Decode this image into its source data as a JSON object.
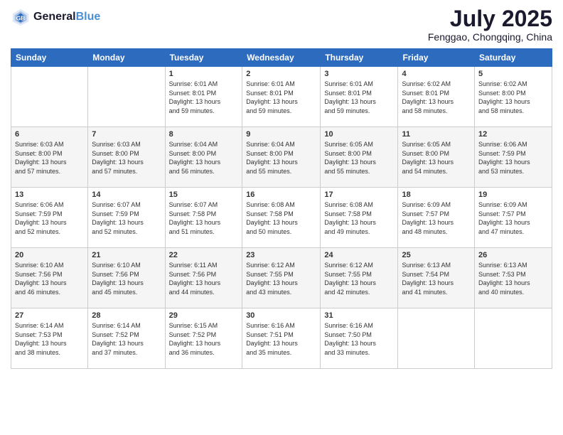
{
  "logo": {
    "text_general": "General",
    "text_blue": "Blue"
  },
  "header": {
    "month": "July 2025",
    "location": "Fenggao, Chongqing, China"
  },
  "days_of_week": [
    "Sunday",
    "Monday",
    "Tuesday",
    "Wednesday",
    "Thursday",
    "Friday",
    "Saturday"
  ],
  "weeks": [
    [
      {
        "day": "",
        "info": ""
      },
      {
        "day": "",
        "info": ""
      },
      {
        "day": "1",
        "info": "Sunrise: 6:01 AM\nSunset: 8:01 PM\nDaylight: 13 hours\nand 59 minutes."
      },
      {
        "day": "2",
        "info": "Sunrise: 6:01 AM\nSunset: 8:01 PM\nDaylight: 13 hours\nand 59 minutes."
      },
      {
        "day": "3",
        "info": "Sunrise: 6:01 AM\nSunset: 8:01 PM\nDaylight: 13 hours\nand 59 minutes."
      },
      {
        "day": "4",
        "info": "Sunrise: 6:02 AM\nSunset: 8:01 PM\nDaylight: 13 hours\nand 58 minutes."
      },
      {
        "day": "5",
        "info": "Sunrise: 6:02 AM\nSunset: 8:00 PM\nDaylight: 13 hours\nand 58 minutes."
      }
    ],
    [
      {
        "day": "6",
        "info": "Sunrise: 6:03 AM\nSunset: 8:00 PM\nDaylight: 13 hours\nand 57 minutes."
      },
      {
        "day": "7",
        "info": "Sunrise: 6:03 AM\nSunset: 8:00 PM\nDaylight: 13 hours\nand 57 minutes."
      },
      {
        "day": "8",
        "info": "Sunrise: 6:04 AM\nSunset: 8:00 PM\nDaylight: 13 hours\nand 56 minutes."
      },
      {
        "day": "9",
        "info": "Sunrise: 6:04 AM\nSunset: 8:00 PM\nDaylight: 13 hours\nand 55 minutes."
      },
      {
        "day": "10",
        "info": "Sunrise: 6:05 AM\nSunset: 8:00 PM\nDaylight: 13 hours\nand 55 minutes."
      },
      {
        "day": "11",
        "info": "Sunrise: 6:05 AM\nSunset: 8:00 PM\nDaylight: 13 hours\nand 54 minutes."
      },
      {
        "day": "12",
        "info": "Sunrise: 6:06 AM\nSunset: 7:59 PM\nDaylight: 13 hours\nand 53 minutes."
      }
    ],
    [
      {
        "day": "13",
        "info": "Sunrise: 6:06 AM\nSunset: 7:59 PM\nDaylight: 13 hours\nand 52 minutes."
      },
      {
        "day": "14",
        "info": "Sunrise: 6:07 AM\nSunset: 7:59 PM\nDaylight: 13 hours\nand 52 minutes."
      },
      {
        "day": "15",
        "info": "Sunrise: 6:07 AM\nSunset: 7:58 PM\nDaylight: 13 hours\nand 51 minutes."
      },
      {
        "day": "16",
        "info": "Sunrise: 6:08 AM\nSunset: 7:58 PM\nDaylight: 13 hours\nand 50 minutes."
      },
      {
        "day": "17",
        "info": "Sunrise: 6:08 AM\nSunset: 7:58 PM\nDaylight: 13 hours\nand 49 minutes."
      },
      {
        "day": "18",
        "info": "Sunrise: 6:09 AM\nSunset: 7:57 PM\nDaylight: 13 hours\nand 48 minutes."
      },
      {
        "day": "19",
        "info": "Sunrise: 6:09 AM\nSunset: 7:57 PM\nDaylight: 13 hours\nand 47 minutes."
      }
    ],
    [
      {
        "day": "20",
        "info": "Sunrise: 6:10 AM\nSunset: 7:56 PM\nDaylight: 13 hours\nand 46 minutes."
      },
      {
        "day": "21",
        "info": "Sunrise: 6:10 AM\nSunset: 7:56 PM\nDaylight: 13 hours\nand 45 minutes."
      },
      {
        "day": "22",
        "info": "Sunrise: 6:11 AM\nSunset: 7:56 PM\nDaylight: 13 hours\nand 44 minutes."
      },
      {
        "day": "23",
        "info": "Sunrise: 6:12 AM\nSunset: 7:55 PM\nDaylight: 13 hours\nand 43 minutes."
      },
      {
        "day": "24",
        "info": "Sunrise: 6:12 AM\nSunset: 7:55 PM\nDaylight: 13 hours\nand 42 minutes."
      },
      {
        "day": "25",
        "info": "Sunrise: 6:13 AM\nSunset: 7:54 PM\nDaylight: 13 hours\nand 41 minutes."
      },
      {
        "day": "26",
        "info": "Sunrise: 6:13 AM\nSunset: 7:53 PM\nDaylight: 13 hours\nand 40 minutes."
      }
    ],
    [
      {
        "day": "27",
        "info": "Sunrise: 6:14 AM\nSunset: 7:53 PM\nDaylight: 13 hours\nand 38 minutes."
      },
      {
        "day": "28",
        "info": "Sunrise: 6:14 AM\nSunset: 7:52 PM\nDaylight: 13 hours\nand 37 minutes."
      },
      {
        "day": "29",
        "info": "Sunrise: 6:15 AM\nSunset: 7:52 PM\nDaylight: 13 hours\nand 36 minutes."
      },
      {
        "day": "30",
        "info": "Sunrise: 6:16 AM\nSunset: 7:51 PM\nDaylight: 13 hours\nand 35 minutes."
      },
      {
        "day": "31",
        "info": "Sunrise: 6:16 AM\nSunset: 7:50 PM\nDaylight: 13 hours\nand 33 minutes."
      },
      {
        "day": "",
        "info": ""
      },
      {
        "day": "",
        "info": ""
      }
    ]
  ]
}
